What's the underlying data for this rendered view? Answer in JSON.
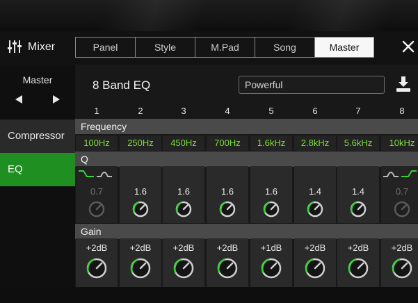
{
  "app": {
    "title": "Mixer"
  },
  "tabs": [
    {
      "label": "Panel",
      "active": false
    },
    {
      "label": "Style",
      "active": false
    },
    {
      "label": "M.Pad",
      "active": false
    },
    {
      "label": "Song",
      "active": false
    },
    {
      "label": "Master",
      "active": true
    }
  ],
  "sidebar": {
    "part_label": "Master",
    "items": [
      {
        "label": "Compressor",
        "active": false
      },
      {
        "label": "EQ",
        "active": true
      }
    ]
  },
  "eq": {
    "title": "8 Band EQ",
    "preset": "Powerful",
    "bands": [
      {
        "num": "1",
        "freq": "100Hz",
        "q": "0.7",
        "q_enabled": false,
        "gain": "+2dB"
      },
      {
        "num": "2",
        "freq": "250Hz",
        "q": "1.6",
        "q_enabled": true,
        "gain": "+2dB"
      },
      {
        "num": "3",
        "freq": "450Hz",
        "q": "1.6",
        "q_enabled": true,
        "gain": "+2dB"
      },
      {
        "num": "4",
        "freq": "700Hz",
        "q": "1.6",
        "q_enabled": true,
        "gain": "+2dB"
      },
      {
        "num": "5",
        "freq": "1.6kHz",
        "q": "1.6",
        "q_enabled": true,
        "gain": "+1dB"
      },
      {
        "num": "6",
        "freq": "2.8kHz",
        "q": "1.4",
        "q_enabled": true,
        "gain": "+2dB"
      },
      {
        "num": "7",
        "freq": "5.6kHz",
        "q": "1.4",
        "q_enabled": true,
        "gain": "+2dB"
      },
      {
        "num": "8",
        "freq": "10kHz",
        "q": "0.7",
        "q_enabled": false,
        "gain": "+2dB"
      }
    ],
    "sections": {
      "frequency": "Frequency",
      "q": "Q",
      "gain": "Gain"
    }
  },
  "colors": {
    "accent_green": "#1f8f22",
    "value_green": "#7ddc3c"
  },
  "icons": {
    "mixer": "mixer-sliders-icon",
    "close": "close-icon",
    "save": "save-download-icon",
    "prev": "arrow-left-icon",
    "next": "arrow-right-icon",
    "low_shelf": "low-shelf-filter-icon",
    "peak": "peak-filter-icon",
    "high_shelf": "high-shelf-filter-icon"
  }
}
